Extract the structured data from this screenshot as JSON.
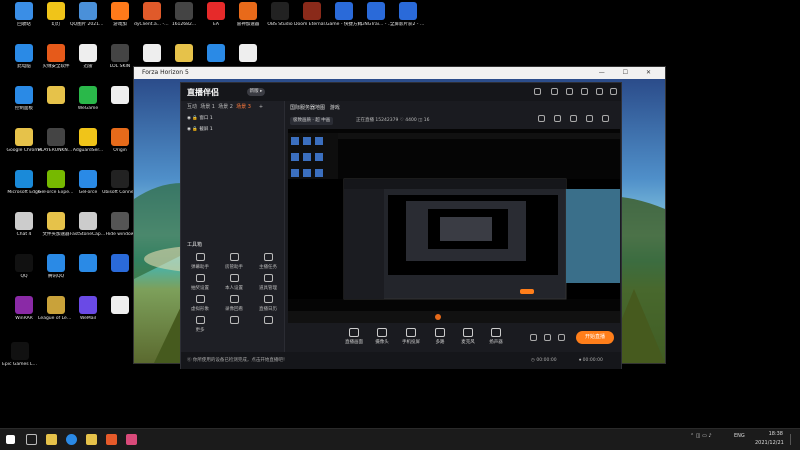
{
  "desktop_icons": [
    {
      "label": "回收站",
      "color": "#3a8ee6"
    },
    {
      "label": "幻灯",
      "color": "#f0c419"
    },
    {
      "label": "QQ图片 20210121...",
      "color": "#4a90d9"
    },
    {
      "label": "游戏加",
      "color": "#ff7a1a"
    },
    {
      "label": "dyClient.a... - 快捷方式",
      "color": "#e05a2a"
    },
    {
      "label": "1612682...",
      "color": "#444"
    },
    {
      "label": "EA",
      "color": "#e62a2a"
    },
    {
      "label": "雷神加速器",
      "color": "#e86a1a"
    },
    {
      "label": "OBS Studio",
      "color": "#222"
    },
    {
      "label": "Doom Eternal - PC",
      "color": "#8a2a1a"
    },
    {
      "label": "Game - 快捷方式",
      "color": "#2a6ad9"
    },
    {
      "label": "FLiNGTrai... - 快捷方式",
      "color": "#2a6ad9"
    },
    {
      "label": "全屏影片获2 - 加速器",
      "color": "#2a6ad9"
    },
    {
      "label": "此电脑",
      "color": "#2a8ae6"
    },
    {
      "label": "火绒安全软件",
      "color": "#e65a1a"
    },
    {
      "label": "迅雷",
      "color": "#eee"
    },
    {
      "label": "LOL SKIN",
      "color": "#444"
    },
    {
      "label": "",
      "color": "#eee"
    },
    {
      "label": "",
      "color": "#e6c24a"
    },
    {
      "label": "",
      "color": "#2a8ae6"
    },
    {
      "label": "",
      "color": "#eee"
    },
    {
      "label": "控制面板",
      "color": "#2a8ae6"
    },
    {
      "label": "",
      "color": "#e6c24a"
    },
    {
      "label": "WeGame",
      "color": "#2ab84a"
    },
    {
      "label": "",
      "color": "#eee"
    },
    {
      "label": "Google Chrome",
      "color": "#e6c24a"
    },
    {
      "label": "PLAYERUNKNOWN'S",
      "color": "#444"
    },
    {
      "label": "AdguardSer...",
      "color": "#f0c419"
    },
    {
      "label": "Origin",
      "color": "#e66a1a"
    },
    {
      "label": "Microsoft Edge",
      "color": "#1a8ad9"
    },
    {
      "label": "GeForce Experience",
      "color": "#76b900"
    },
    {
      "label": "GeForce",
      "color": "#2a8ae6"
    },
    {
      "label": "Ubisoft Connect",
      "color": "#222"
    },
    {
      "label": "Chat 4",
      "color": "#ccc"
    },
    {
      "label": "文件夹加速器",
      "color": "#e6c24a"
    },
    {
      "label": "FastStoneCapture",
      "color": "#ccc"
    },
    {
      "label": "Hide window",
      "color": "#555"
    },
    {
      "label": "QQ",
      "color": "#111"
    },
    {
      "label": "腾讯QQ",
      "color": "#2a8ae6"
    },
    {
      "label": "",
      "color": "#2a8ae6"
    },
    {
      "label": "",
      "color": "#2a6ad9"
    },
    {
      "label": "WinRAR",
      "color": "#8a2aa6"
    },
    {
      "label": "League of Legends",
      "color": "#c9a23a"
    },
    {
      "label": "WeMail",
      "color": "#6a4ae6"
    },
    {
      "label": "",
      "color": "#eee"
    },
    {
      "label": "Epic Games Launcher",
      "color": "#111"
    }
  ],
  "forza": {
    "title": "Forza Horizon 5",
    "controls": "— ☐ ✕"
  },
  "app": {
    "logo": "直播伴侣",
    "version_badge": "新版 ▸",
    "scene_tabs": [
      "互动",
      "场景 1",
      "场景 2",
      "场景 3",
      "+"
    ],
    "active_tab": "场景 3",
    "sources": [
      "窗口 1",
      "截屏 1"
    ],
    "tools_title": "工具箱",
    "tools": [
      {
        "label": "弹幕助手",
        "icon": "chat-icon"
      },
      {
        "label": "房管助手",
        "icon": "user-icon"
      },
      {
        "label": "主播任务",
        "icon": "task-icon"
      },
      {
        "label": "抽奖设置",
        "icon": "gift-icon"
      },
      {
        "label": "本人设置",
        "icon": "download-icon"
      },
      {
        "label": "道具管理",
        "icon": "box-icon"
      },
      {
        "label": "虚拟形象",
        "icon": "avatar-icon"
      },
      {
        "label": "录像回看",
        "icon": "record-icon"
      },
      {
        "label": "直播日历",
        "icon": "calendar-icon"
      },
      {
        "label": "更多",
        "icon": "more-icon"
      },
      {
        "label": "",
        "icon": "download-icon"
      },
      {
        "label": "",
        "icon": "settings-icon"
      }
    ],
    "room_title": "国际服务器地图",
    "room_tag": "游戏",
    "live_badge": "极致画质 · 超 中画",
    "stats_text": "正在直播 15242379  ♡ 4400  ◫ 16",
    "bottom_buttons": [
      {
        "label": "直播画面",
        "icon": "monitor-icon"
      },
      {
        "label": "摄像头",
        "icon": "camera-icon"
      },
      {
        "label": "手机投屏",
        "icon": "phone-icon"
      },
      {
        "label": "多路",
        "icon": "layers-icon"
      },
      {
        "label": "麦克风",
        "icon": "mic-icon"
      },
      {
        "label": "扬声器",
        "icon": "speaker-icon"
      }
    ],
    "go_live_label": "开始直播",
    "status_hint": "⓪ 你所使用的设备已检测完成，点击开始直播吧！",
    "status_times": [
      "◷ 00:00:00",
      "⏺ 00:00:00"
    ]
  },
  "taskbar": {
    "clock_time": "18:38",
    "clock_date": "2021/12/21",
    "lang": "ENG"
  }
}
